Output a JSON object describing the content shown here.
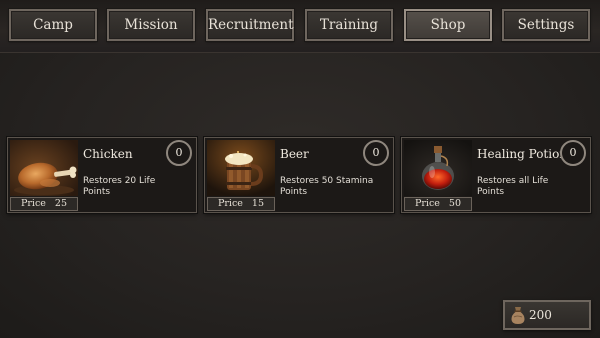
{
  "nav": {
    "tabs": [
      {
        "label": "Camp"
      },
      {
        "label": "Mission"
      },
      {
        "label": "Recruitment"
      },
      {
        "label": "Training"
      },
      {
        "label": "Shop",
        "active": true
      },
      {
        "label": "Settings"
      }
    ]
  },
  "shop": {
    "price_label": "Price",
    "items": [
      {
        "name": "Chicken",
        "description": "Restores 20 Life Points",
        "price": "25",
        "quantity": "0",
        "icon": "roast-chicken-icon"
      },
      {
        "name": "Beer",
        "description": "Restores 50 Stamina Points",
        "price": "15",
        "quantity": "0",
        "icon": "beer-mug-icon"
      },
      {
        "name": "Healing Potion",
        "description": "Restores all Life Points",
        "price": "50",
        "quantity": "0",
        "icon": "potion-bottle-icon"
      }
    ]
  },
  "wallet": {
    "amount": "200",
    "icon": "coin-pouch-icon"
  },
  "colors": {
    "background": "#262321",
    "panel_border": "#6e665e",
    "text": "#e8e2d8"
  }
}
